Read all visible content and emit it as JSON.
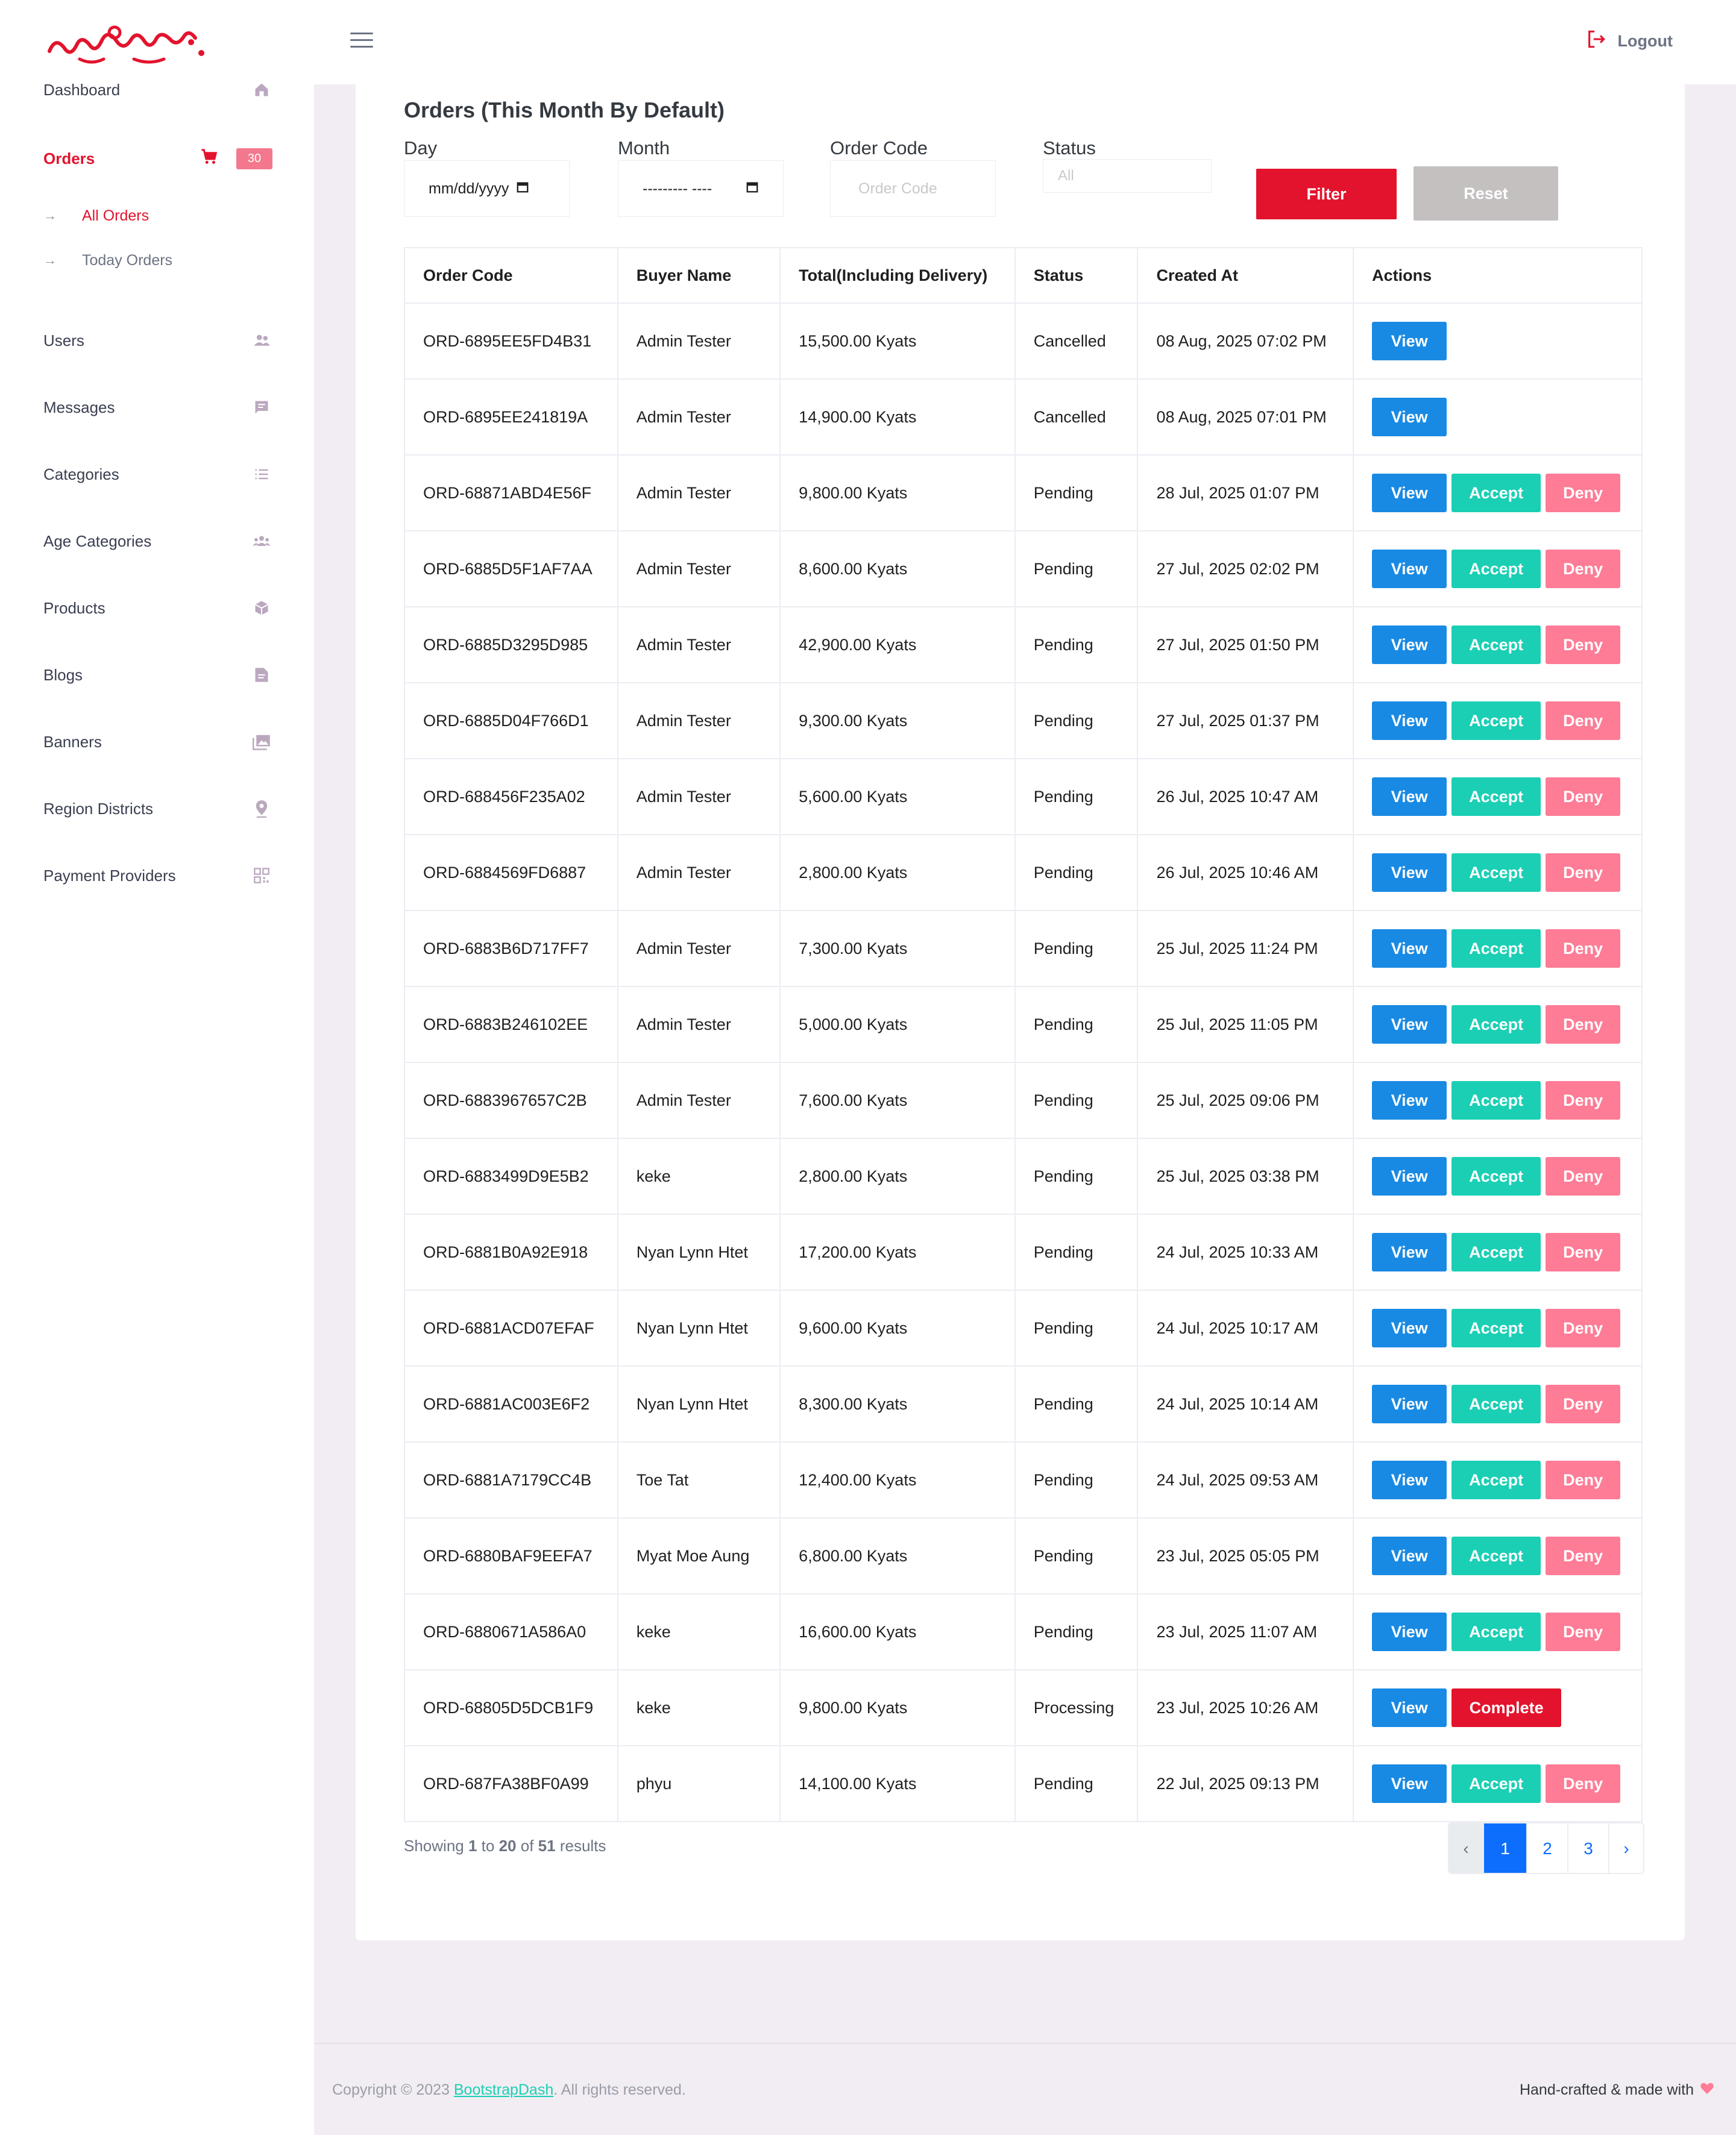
{
  "brand": {
    "logo_text": "ရွှေမိုးကြိုး",
    "accent": "#e3132d"
  },
  "sidebar": {
    "dashboard": "Dashboard",
    "orders": {
      "label": "Orders",
      "badge": "30"
    },
    "orders_sub": {
      "all": "All Orders",
      "today": "Today Orders"
    },
    "users": "Users",
    "messages": "Messages",
    "categories": "Categories",
    "age_categories": "Age Categories",
    "products": "Products",
    "blogs": "Blogs",
    "banners": "Banners",
    "region_districts": "Region Districts",
    "payment_providers": "Payment Providers"
  },
  "topbar": {
    "logout": "Logout"
  },
  "page": {
    "title": "Orders (This Month By Default)"
  },
  "filters": {
    "day_label": "Day",
    "day_value": "mm/dd/yyyy",
    "month_label": "Month",
    "month_value": "--------- ----",
    "code_label": "Order Code",
    "code_placeholder": "Order Code",
    "status_label": "Status",
    "status_value": "All",
    "filter_btn": "Filter",
    "reset_btn": "Reset"
  },
  "table": {
    "headers": [
      "Order Code",
      "Buyer Name",
      "Total(Including Delivery)",
      "Status",
      "Created At",
      "Actions"
    ],
    "actions": {
      "view": "View",
      "accept": "Accept",
      "deny": "Deny",
      "complete": "Complete"
    },
    "rows": [
      {
        "code": "ORD-6895EE5FD4B31",
        "buyer": "Admin Tester",
        "total": "15,500.00 Kyats",
        "status": "Cancelled",
        "created": "08 Aug, 2025 07:02 PM"
      },
      {
        "code": "ORD-6895EE241819A",
        "buyer": "Admin Tester",
        "total": "14,900.00 Kyats",
        "status": "Cancelled",
        "created": "08 Aug, 2025 07:01 PM"
      },
      {
        "code": "ORD-68871ABD4E56F",
        "buyer": "Admin Tester",
        "total": "9,800.00 Kyats",
        "status": "Pending",
        "created": "28 Jul, 2025 01:07 PM"
      },
      {
        "code": "ORD-6885D5F1AF7AA",
        "buyer": "Admin Tester",
        "total": "8,600.00 Kyats",
        "status": "Pending",
        "created": "27 Jul, 2025 02:02 PM"
      },
      {
        "code": "ORD-6885D3295D985",
        "buyer": "Admin Tester",
        "total": "42,900.00 Kyats",
        "status": "Pending",
        "created": "27 Jul, 2025 01:50 PM"
      },
      {
        "code": "ORD-6885D04F766D1",
        "buyer": "Admin Tester",
        "total": "9,300.00 Kyats",
        "status": "Pending",
        "created": "27 Jul, 2025 01:37 PM"
      },
      {
        "code": "ORD-688456F235A02",
        "buyer": "Admin Tester",
        "total": "5,600.00 Kyats",
        "status": "Pending",
        "created": "26 Jul, 2025 10:47 AM"
      },
      {
        "code": "ORD-6884569FD6887",
        "buyer": "Admin Tester",
        "total": "2,800.00 Kyats",
        "status": "Pending",
        "created": "26 Jul, 2025 10:46 AM"
      },
      {
        "code": "ORD-6883B6D717FF7",
        "buyer": "Admin Tester",
        "total": "7,300.00 Kyats",
        "status": "Pending",
        "created": "25 Jul, 2025 11:24 PM"
      },
      {
        "code": "ORD-6883B246102EE",
        "buyer": "Admin Tester",
        "total": "5,000.00 Kyats",
        "status": "Pending",
        "created": "25 Jul, 2025 11:05 PM"
      },
      {
        "code": "ORD-6883967657C2B",
        "buyer": "Admin Tester",
        "total": "7,600.00 Kyats",
        "status": "Pending",
        "created": "25 Jul, 2025 09:06 PM"
      },
      {
        "code": "ORD-6883499D9E5B2",
        "buyer": "keke",
        "total": "2,800.00 Kyats",
        "status": "Pending",
        "created": "25 Jul, 2025 03:38 PM"
      },
      {
        "code": "ORD-6881B0A92E918",
        "buyer": "Nyan Lynn Htet",
        "total": "17,200.00 Kyats",
        "status": "Pending",
        "created": "24 Jul, 2025 10:33 AM"
      },
      {
        "code": "ORD-6881ACD07EFAF",
        "buyer": "Nyan Lynn Htet",
        "total": "9,600.00 Kyats",
        "status": "Pending",
        "created": "24 Jul, 2025 10:17 AM"
      },
      {
        "code": "ORD-6881AC003E6F2",
        "buyer": "Nyan Lynn Htet",
        "total": "8,300.00 Kyats",
        "status": "Pending",
        "created": "24 Jul, 2025 10:14 AM"
      },
      {
        "code": "ORD-6881A7179CC4B",
        "buyer": "Toe Tat",
        "total": "12,400.00 Kyats",
        "status": "Pending",
        "created": "24 Jul, 2025 09:53 AM"
      },
      {
        "code": "ORD-6880BAF9EEFA7",
        "buyer": "Myat Moe Aung",
        "total": "6,800.00 Kyats",
        "status": "Pending",
        "created": "23 Jul, 2025 05:05 PM"
      },
      {
        "code": "ORD-6880671A586A0",
        "buyer": "keke",
        "total": "16,600.00 Kyats",
        "status": "Pending",
        "created": "23 Jul, 2025 11:07 AM"
      },
      {
        "code": "ORD-68805D5DCB1F9",
        "buyer": "keke",
        "total": "9,800.00 Kyats",
        "status": "Processing",
        "created": "23 Jul, 2025 10:26 AM"
      },
      {
        "code": "ORD-687FA38BF0A99",
        "buyer": "phyu",
        "total": "14,100.00 Kyats",
        "status": "Pending",
        "created": "22 Jul, 2025 09:13 PM"
      }
    ]
  },
  "pagination": {
    "showing_prefix": "Showing",
    "from": "1",
    "to_word": "to",
    "to": "20",
    "of_word": "of",
    "total": "51",
    "results_word": "results",
    "prev": "‹",
    "pages": [
      "1",
      "2",
      "3"
    ],
    "next": "›"
  },
  "footer": {
    "copyright_prefix": "Copyright © 2023",
    "link": "BootstrapDash",
    "rights": ". All rights reserved.",
    "handcrafted": "Hand-crafted & made with"
  },
  "colors": {
    "cancelled_total": "#f3788d",
    "pending_total": "#fcc324",
    "processing_total": "#e3132d",
    "view": "#198ae3",
    "accept": "#1bcfb4",
    "deny": "#fe7c96"
  }
}
